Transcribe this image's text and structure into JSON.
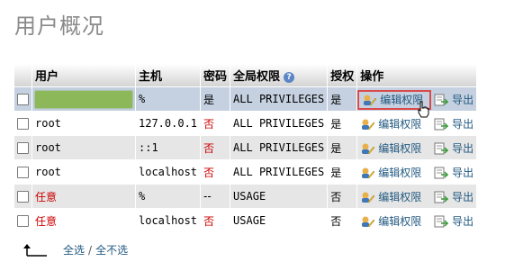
{
  "page": {
    "title": "用户概况"
  },
  "table": {
    "headers": {
      "user": "用户",
      "host": "主机",
      "password": "密码",
      "privileges": "全局权限",
      "grant": "授权",
      "actions": "操作"
    },
    "rows": [
      {
        "user": "",
        "host": "%",
        "password": "是",
        "privileges": "ALL PRIVILEGES",
        "grant": "是",
        "edit": "编辑权限",
        "export": "导出"
      },
      {
        "user": "root",
        "host": "127.0.0.1",
        "password": "否",
        "privileges": "ALL PRIVILEGES",
        "grant": "是",
        "edit": "编辑权限",
        "export": "导出"
      },
      {
        "user": "root",
        "host": "::1",
        "password": "否",
        "privileges": "ALL PRIVILEGES",
        "grant": "是",
        "edit": "编辑权限",
        "export": "导出"
      },
      {
        "user": "root",
        "host": "localhost",
        "password": "否",
        "privileges": "ALL PRIVILEGES",
        "grant": "是",
        "edit": "编辑权限",
        "export": "导出"
      },
      {
        "user": "任意",
        "host": "%",
        "password": "--",
        "privileges": "USAGE",
        "grant": "否",
        "edit": "编辑权限",
        "export": "导出"
      },
      {
        "user": "任意",
        "host": "localhost",
        "password": "否",
        "privileges": "USAGE",
        "grant": "否",
        "edit": "编辑权限",
        "export": "导出"
      }
    ]
  },
  "footer": {
    "select_all": "全选",
    "separator": "/",
    "select_none": "全不选"
  },
  "colors": {
    "link": "#235a81",
    "red": "#cc0000",
    "highlight": "#d94b4b",
    "redacted": "#8db85a"
  }
}
